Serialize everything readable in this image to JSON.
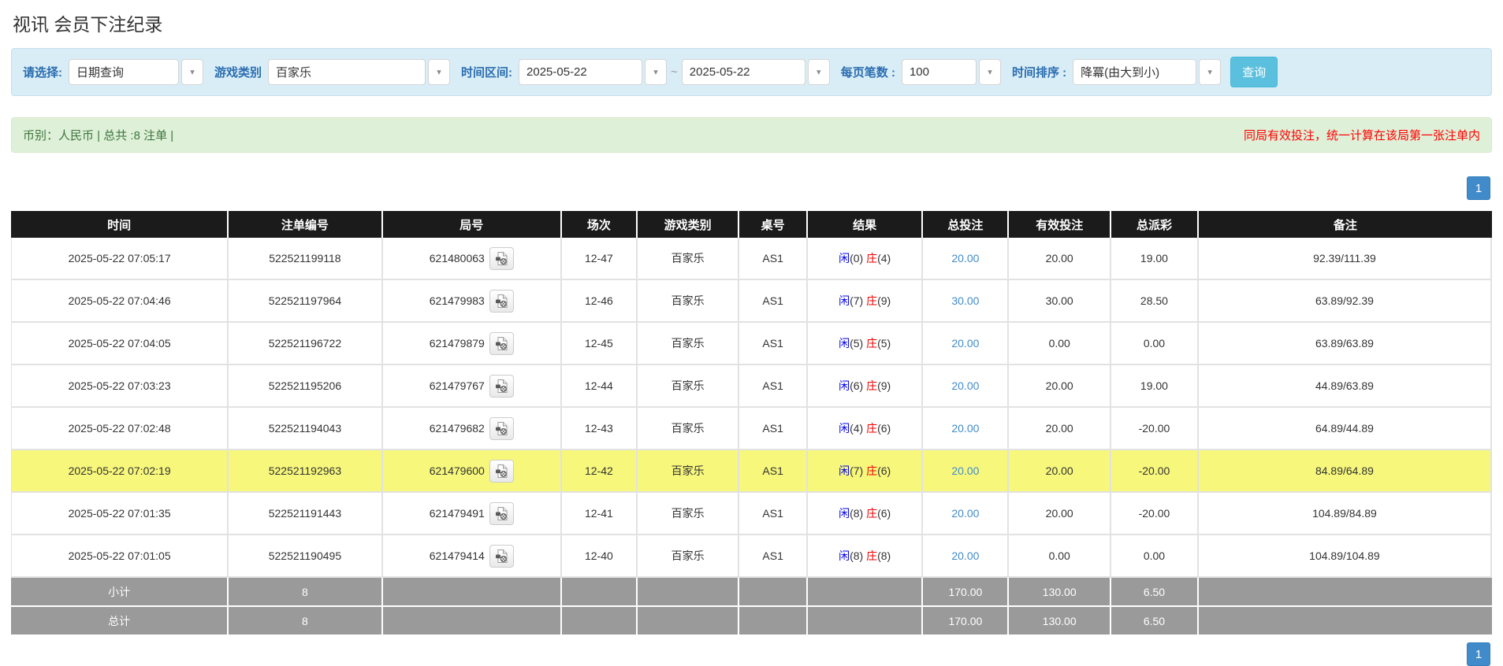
{
  "page": {
    "title": "视讯 会员下注纪录"
  },
  "filters": {
    "select_label": "请选择:",
    "select_value": "日期查询",
    "game_type_label": "游戏类别",
    "game_type_value": "百家乐",
    "date_range_label": "时间区间:",
    "date_from": "2025-05-22",
    "date_separator": "~",
    "date_to": "2025-05-22",
    "page_size_label": "每页笔数 :",
    "page_size_value": "100",
    "sort_label": "时间排序 :",
    "sort_value": "降冪(由大到小)",
    "search_button": "查询"
  },
  "summary": {
    "left": "币别：人民币 | 总共 :8 注单 |",
    "right": "同局有效投注，统一计算在该局第一张注单内"
  },
  "pagination": {
    "page": "1"
  },
  "icons": {
    "dropdown": "chevron-down-icon",
    "round_video": "video-file-icon"
  },
  "colors": {
    "filter_bg": "#d9edf7",
    "label_blue": "#2a6db0",
    "summary_bg": "#dff0d8",
    "summary_green": "#3c763d",
    "note_red": "#ff0000",
    "header_bg": "#1b1b1b",
    "highlight_yellow": "#f7f77c",
    "footer_gray": "#9a9a9a",
    "link_blue": "#428bca",
    "player_blue": "#0000ee",
    "banker_red": "#ee0000",
    "search_btn": "#5bc0de",
    "pager_blue": "#428bca"
  },
  "table": {
    "headers": [
      "时间",
      "注单编号",
      "局号",
      "场次",
      "游戏类别",
      "桌号",
      "结果",
      "总投注",
      "有效投注",
      "总派彩",
      "备注"
    ],
    "rows": [
      {
        "time": "2025-05-22 07:05:17",
        "bet_id": "522521199118",
        "round_id": "621480063",
        "session": "12-47",
        "game": "百家乐",
        "table_no": "AS1",
        "result": {
          "player": "闲(0)",
          "banker": "庄(4)"
        },
        "total_bet": "20.00",
        "valid_bet": "20.00",
        "payout": "19.00",
        "remark": "92.39/111.39",
        "highlighted": false
      },
      {
        "time": "2025-05-22 07:04:46",
        "bet_id": "522521197964",
        "round_id": "621479983",
        "session": "12-46",
        "game": "百家乐",
        "table_no": "AS1",
        "result": {
          "player": "闲(7)",
          "banker": "庄(9)"
        },
        "total_bet": "30.00",
        "valid_bet": "30.00",
        "payout": "28.50",
        "remark": "63.89/92.39",
        "highlighted": false
      },
      {
        "time": "2025-05-22 07:04:05",
        "bet_id": "522521196722",
        "round_id": "621479879",
        "session": "12-45",
        "game": "百家乐",
        "table_no": "AS1",
        "result": {
          "player": "闲(5)",
          "banker": "庄(5)"
        },
        "total_bet": "20.00",
        "valid_bet": "0.00",
        "payout": "0.00",
        "remark": "63.89/63.89",
        "highlighted": false
      },
      {
        "time": "2025-05-22 07:03:23",
        "bet_id": "522521195206",
        "round_id": "621479767",
        "session": "12-44",
        "game": "百家乐",
        "table_no": "AS1",
        "result": {
          "player": "闲(6)",
          "banker": "庄(9)"
        },
        "total_bet": "20.00",
        "valid_bet": "20.00",
        "payout": "19.00",
        "remark": "44.89/63.89",
        "highlighted": false
      },
      {
        "time": "2025-05-22 07:02:48",
        "bet_id": "522521194043",
        "round_id": "621479682",
        "session": "12-43",
        "game": "百家乐",
        "table_no": "AS1",
        "result": {
          "player": "闲(4)",
          "banker": "庄(6)"
        },
        "total_bet": "20.00",
        "valid_bet": "20.00",
        "payout": "-20.00",
        "remark": "64.89/44.89",
        "highlighted": false
      },
      {
        "time": "2025-05-22 07:02:19",
        "bet_id": "522521192963",
        "round_id": "621479600",
        "session": "12-42",
        "game": "百家乐",
        "table_no": "AS1",
        "result": {
          "player": "闲(7)",
          "banker": "庄(6)"
        },
        "total_bet": "20.00",
        "valid_bet": "20.00",
        "payout": "-20.00",
        "remark": "84.89/64.89",
        "highlighted": true
      },
      {
        "time": "2025-05-22 07:01:35",
        "bet_id": "522521191443",
        "round_id": "621479491",
        "session": "12-41",
        "game": "百家乐",
        "table_no": "AS1",
        "result": {
          "player": "闲(8)",
          "banker": "庄(6)"
        },
        "total_bet": "20.00",
        "valid_bet": "20.00",
        "payout": "-20.00",
        "remark": "104.89/84.89",
        "highlighted": false
      },
      {
        "time": "2025-05-22 07:01:05",
        "bet_id": "522521190495",
        "round_id": "621479414",
        "session": "12-40",
        "game": "百家乐",
        "table_no": "AS1",
        "result": {
          "player": "闲(8)",
          "banker": "庄(8)"
        },
        "total_bet": "20.00",
        "valid_bet": "0.00",
        "payout": "0.00",
        "remark": "104.89/104.89",
        "highlighted": false
      }
    ],
    "subtotal": {
      "label": "小计",
      "count": "8",
      "total_bet": "170.00",
      "valid_bet": "130.00",
      "payout": "6.50"
    },
    "total": {
      "label": "总计",
      "count": "8",
      "total_bet": "170.00",
      "valid_bet": "130.00",
      "payout": "6.50"
    }
  }
}
